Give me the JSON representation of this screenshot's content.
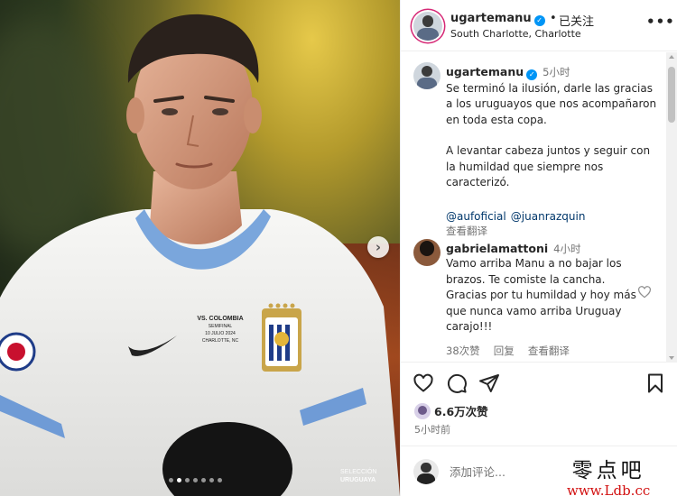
{
  "post": {
    "username": "ugartemanu",
    "verified_mark": "✓",
    "separator": "•",
    "follow_state": "已关注",
    "location": "South Charlotte, Charlotte",
    "more_icon": "more-horizontal-icon",
    "more_label": "•••"
  },
  "media": {
    "jersey": {
      "text_main": "VS. COLOMBIA",
      "text_sub": "SEMIFINAL",
      "text_date": "10 JULIO 2024",
      "text_place": "CHARLOTTE, NC"
    },
    "watermark": {
      "line1": "SELECCIÓN",
      "line2": "URUGUAYA"
    },
    "next_icon": "chevron-right-icon",
    "next_label": "›",
    "carousel": {
      "count": 7,
      "active": 1
    }
  },
  "caption": {
    "username": "ugartemanu",
    "time": "5小时",
    "paragraph1": "Se terminó la ilusión, darle las gracias a los uruguayos que nos acompañaron en toda esta copa.",
    "paragraph2": "A levantar cabeza juntos y seguir con la humildad que siempre nos caracterizó.",
    "mention1": "@aufoficial",
    "mention2": "@juanrazquin",
    "translate": "查看翻译"
  },
  "comment": {
    "username": "gabrielamattoni",
    "time": "4小时",
    "text": "Vamo arriba Manu a no bajar los brazos. Te comiste la cancha. Gracias por tu humildad y hoy más que nunca vamo arriba Uruguay carajo!!!",
    "likes": "38次赞",
    "reply": "回复",
    "translate": "查看翻译"
  },
  "actions": {
    "like_icon": "heart-icon",
    "comment_icon": "comment-icon",
    "share_icon": "send-icon",
    "save_icon": "bookmark-icon"
  },
  "stats": {
    "likes": "6.6万次赞",
    "posted": "5小时前"
  },
  "add_comment": {
    "placeholder": "添加评论..."
  },
  "site_watermark": {
    "zh": "零点吧",
    "url": "www.Ldb.cc"
  },
  "colors": {
    "link": "#00376b",
    "verified": "#0095f6",
    "secondary_text": "#737373",
    "watermark_url": "#d21010"
  }
}
